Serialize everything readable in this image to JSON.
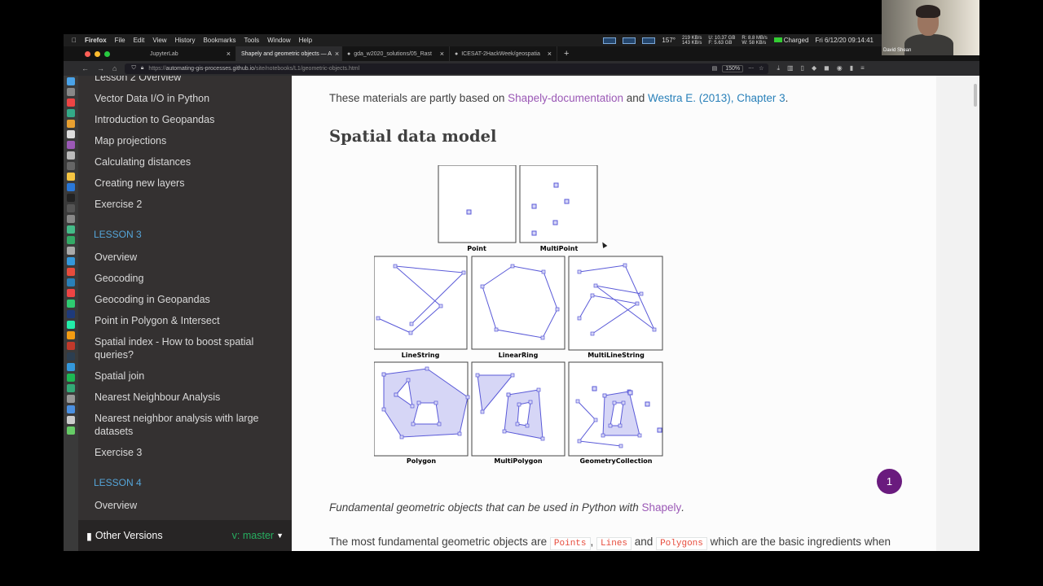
{
  "menubar": {
    "app": "Firefox",
    "menus": [
      "File",
      "Edit",
      "View",
      "History",
      "Bookmarks",
      "Tools",
      "Window",
      "Help"
    ],
    "temp": "157°",
    "net_up": "219 KB/s",
    "net_down": "143 KB/s",
    "mem_used": "U: 10.37 GB",
    "mem_free": "F: 5.63 GB",
    "disk_read": "R: 8.8 MB/s",
    "disk_write": "W: 58 KB/s",
    "battery": "Charged",
    "datetime": "Fri 6/12/20 09:14:41"
  },
  "tabs": [
    {
      "label": "JupyterLab",
      "active": false
    },
    {
      "label": "Shapely and geometric objects — A",
      "active": true
    },
    {
      "label": "gda_w2020_solutions/05_Rast",
      "active": false
    },
    {
      "label": "ICESAT-2HackWeek/geospatia",
      "active": false
    }
  ],
  "url": {
    "scheme": "https://",
    "host": "automating-gis-processes.github.io",
    "path": "/site/notebooks/L1/geometric-objects.html",
    "zoom": "150%"
  },
  "webcam_name": "David Shean",
  "sidebar": {
    "items_a": [
      "Lesson 2 Overview",
      "Vector Data I/O in Python",
      "Introduction to Geopandas",
      "Map projections",
      "Calculating distances",
      "Creating new layers",
      "Exercise 2"
    ],
    "caption_lesson3": "LESSON 3",
    "items_b": [
      "Overview",
      "Geocoding",
      "Geocoding in Geopandas",
      "Point in Polygon & Intersect",
      "Spatial index - How to boost spatial queries?",
      "Spatial join",
      "Nearest Neighbour Analysis",
      "Nearest neighbor analysis with large datasets",
      "Exercise 3"
    ],
    "caption_lesson4": "LESSON 4",
    "items_c": [
      "Overview"
    ],
    "versions_label": "Other Versions",
    "branch": "v: master"
  },
  "content": {
    "intro_prefix": "These materials are partly based on ",
    "intro_link1": "Shapely-documentation",
    "intro_and": " and ",
    "intro_link2": "Westra E. (2013), Chapter 3",
    "intro_suffix": ".",
    "heading": "Spatial data model",
    "figure_captions": [
      "Point",
      "MultiPoint",
      "LineString",
      "LinearRing",
      "MultiLineString",
      "Polygon",
      "MultiPolygon",
      "GeometryCollection"
    ],
    "caption_text": "Fundamental geometric objects that can be used in Python with ",
    "caption_link": "Shapely",
    "caption_end": ".",
    "para_prefix": "The most fundamental geometric objects are ",
    "code1": "Points",
    "sep1": ", ",
    "code2": "Lines",
    "and": " and ",
    "code3": "Polygons",
    "para_suffix": " which are the basic ingredients when"
  },
  "badge": "1",
  "colors": {
    "sidebar_bg": "#343131",
    "caption_blue": "#55a5d9",
    "link_purple": "#9b59b6",
    "link_blue": "#2980b9",
    "code_red": "#e74c3c",
    "geom": "#5a5ad8",
    "geom_fill": "#d6d6f6",
    "badge": "#6a1b7e"
  }
}
